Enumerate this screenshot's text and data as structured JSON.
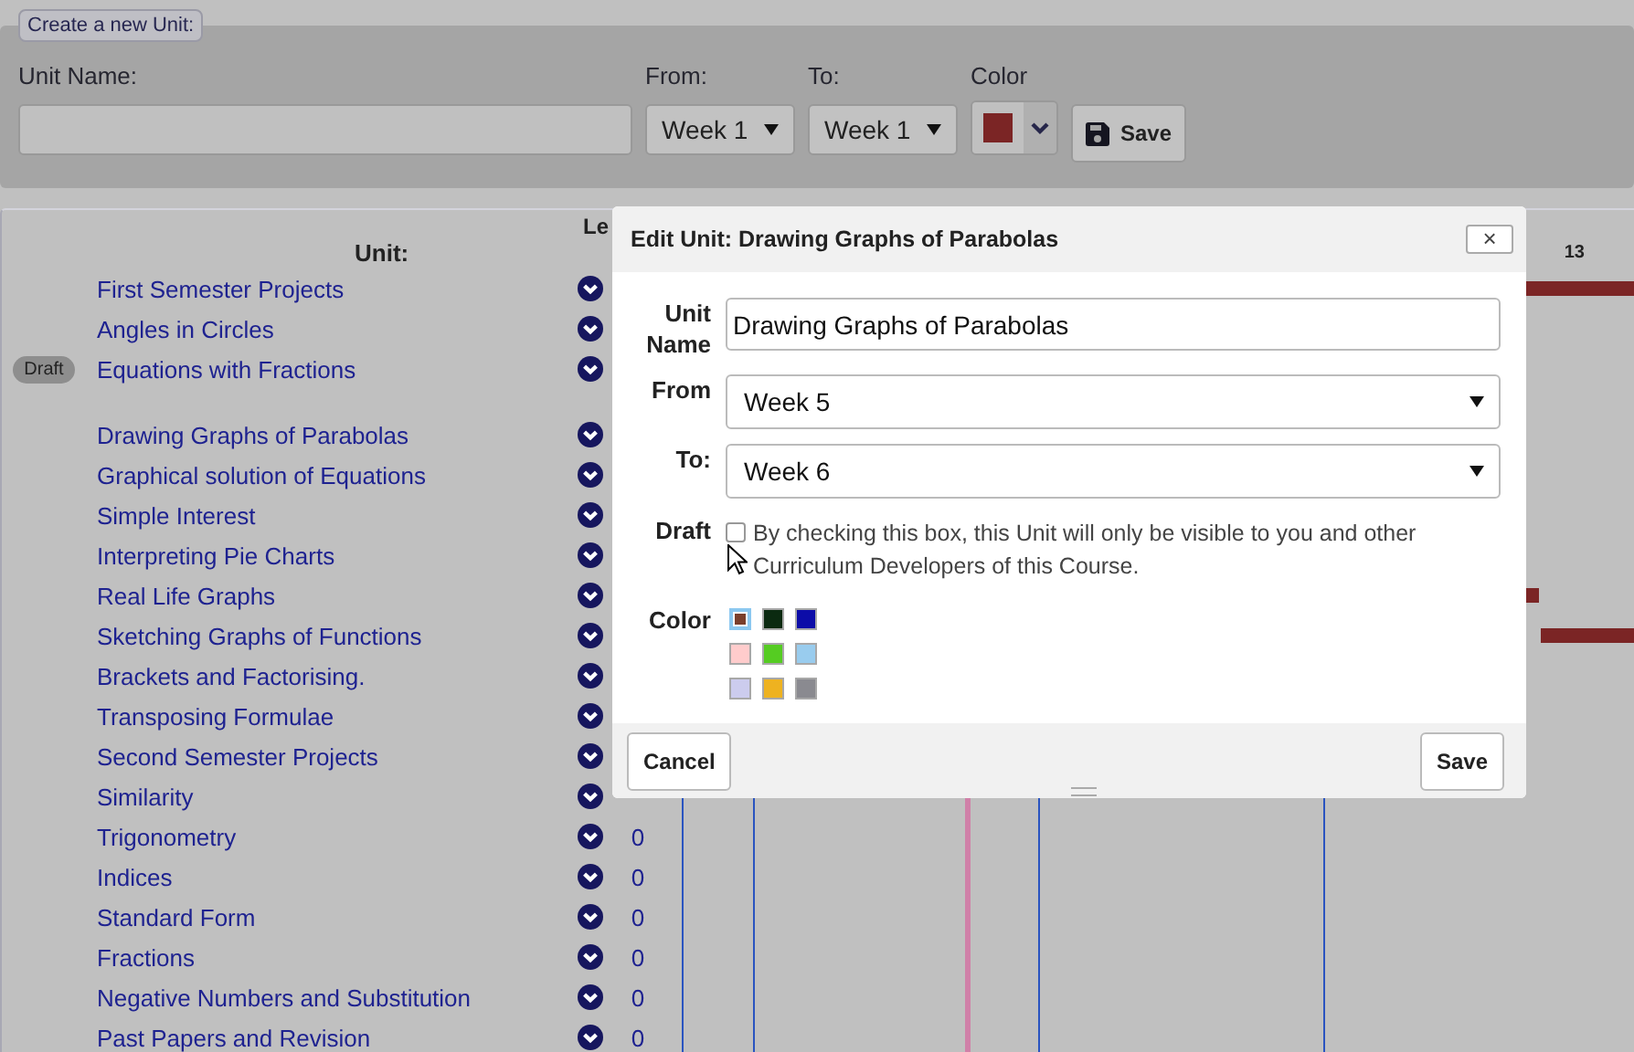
{
  "create_form": {
    "legend": "Create a new Unit:",
    "unit_name_label": "Unit Name:",
    "from_label": "From:",
    "from_value": "Week 1",
    "to_label": "To:",
    "to_value": "Week 1",
    "color_label": "Color",
    "color": "#7b2525",
    "save": "Save"
  },
  "unit_list": {
    "header_unit": "Unit:",
    "header_column_2": "Le",
    "header_week": "13",
    "units": [
      {
        "kind": "unit",
        "name": "First Semester Projects",
        "bar": {
          "kind": "span",
          "color": "#7b2525"
        }
      },
      {
        "kind": "unit",
        "name": "Angles in Circles"
      },
      {
        "kind": "unit",
        "name": "Equations with Fractions",
        "badge": "Draft"
      },
      {
        "kind": "spacer"
      },
      {
        "kind": "unit",
        "name": "Drawing Graphs of Parabolas"
      },
      {
        "kind": "unit",
        "name": "Graphical solution of Equations"
      },
      {
        "kind": "unit",
        "name": "Simple Interest"
      },
      {
        "kind": "unit",
        "name": "Interpreting Pie Charts"
      },
      {
        "kind": "unit",
        "name": "Real Life Graphs",
        "bar": {
          "kind": "end",
          "color": "#7b2525"
        }
      },
      {
        "kind": "unit",
        "name": "Sketching Graphs of Functions",
        "bar": {
          "kind": "start",
          "color": "#7b2525"
        }
      },
      {
        "kind": "unit",
        "name": "Brackets and Factorising."
      },
      {
        "kind": "unit",
        "name": "Transposing Formulae"
      },
      {
        "kind": "unit",
        "name": "Second Semester Projects"
      },
      {
        "kind": "unit",
        "name": "Similarity"
      },
      {
        "kind": "unit",
        "name": "Trigonometry",
        "count": "0"
      },
      {
        "kind": "unit",
        "name": "Indices",
        "count": "0"
      },
      {
        "kind": "unit",
        "name": "Standard Form",
        "count": "0"
      },
      {
        "kind": "unit",
        "name": "Fractions",
        "count": "0"
      },
      {
        "kind": "unit",
        "name": "Negative Numbers and Substitution",
        "count": "0"
      },
      {
        "kind": "unit",
        "name": "Past Papers and Revision",
        "count": "0"
      }
    ]
  },
  "dialog": {
    "title": "Edit Unit: Drawing Graphs of Parabolas",
    "close": "×",
    "unit_name_label": "Unit Name",
    "unit_name_value": "Drawing Graphs of Parabolas",
    "from_label": "From",
    "from_value": "Week 5",
    "to_label": "To:",
    "to_value": "Week 6",
    "draft_label": "Draft",
    "draft_checked": false,
    "draft_text": "By checking this box, this Unit will only be visible to you and other Curriculum Developers of this Course.",
    "color_label": "Color",
    "colors": [
      {
        "color": "#7a3f2c",
        "selected": true
      },
      {
        "color": "#0b2a10",
        "selected": false
      },
      {
        "color": "#0c0ca8",
        "selected": false
      },
      {
        "color": "#ffcccc",
        "selected": false
      },
      {
        "color": "#55cc22",
        "selected": false
      },
      {
        "color": "#99ccee",
        "selected": false
      },
      {
        "color": "#ccccee",
        "selected": false
      },
      {
        "color": "#eeb220",
        "selected": false
      },
      {
        "color": "#8a8a90",
        "selected": false
      }
    ],
    "cancel": "Cancel",
    "save": "Save"
  }
}
